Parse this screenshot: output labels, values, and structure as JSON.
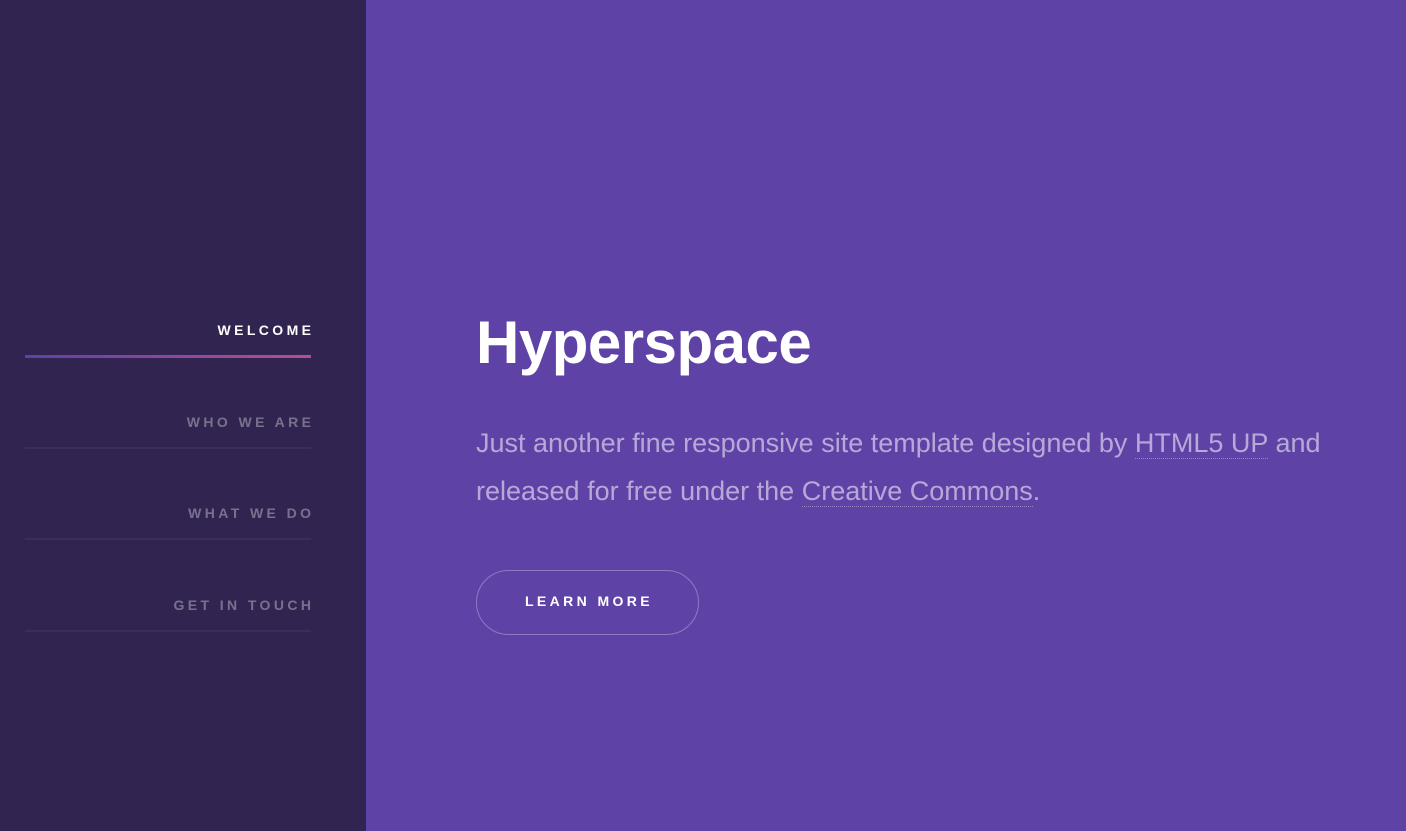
{
  "sidebar": {
    "items": [
      {
        "label": "WELCOME",
        "active": true
      },
      {
        "label": "WHO WE ARE",
        "active": false
      },
      {
        "label": "WHAT WE DO",
        "active": false
      },
      {
        "label": "GET IN TOUCH",
        "active": false
      }
    ]
  },
  "main": {
    "title": "Hyperspace",
    "intro": {
      "text_before_link1": "Just another fine responsive site template designed by ",
      "link1": "HTML5 UP",
      "text_before_link2": " and released for free under the ",
      "link2": "Creative Commons",
      "text_after": "."
    },
    "button_label": "LEARN MORE"
  },
  "colors": {
    "sidebar_bg": "#312450",
    "main_bg": "#5e42a6",
    "accent_gradient_start": "#5e42a6",
    "accent_gradient_end": "#b74e91"
  }
}
